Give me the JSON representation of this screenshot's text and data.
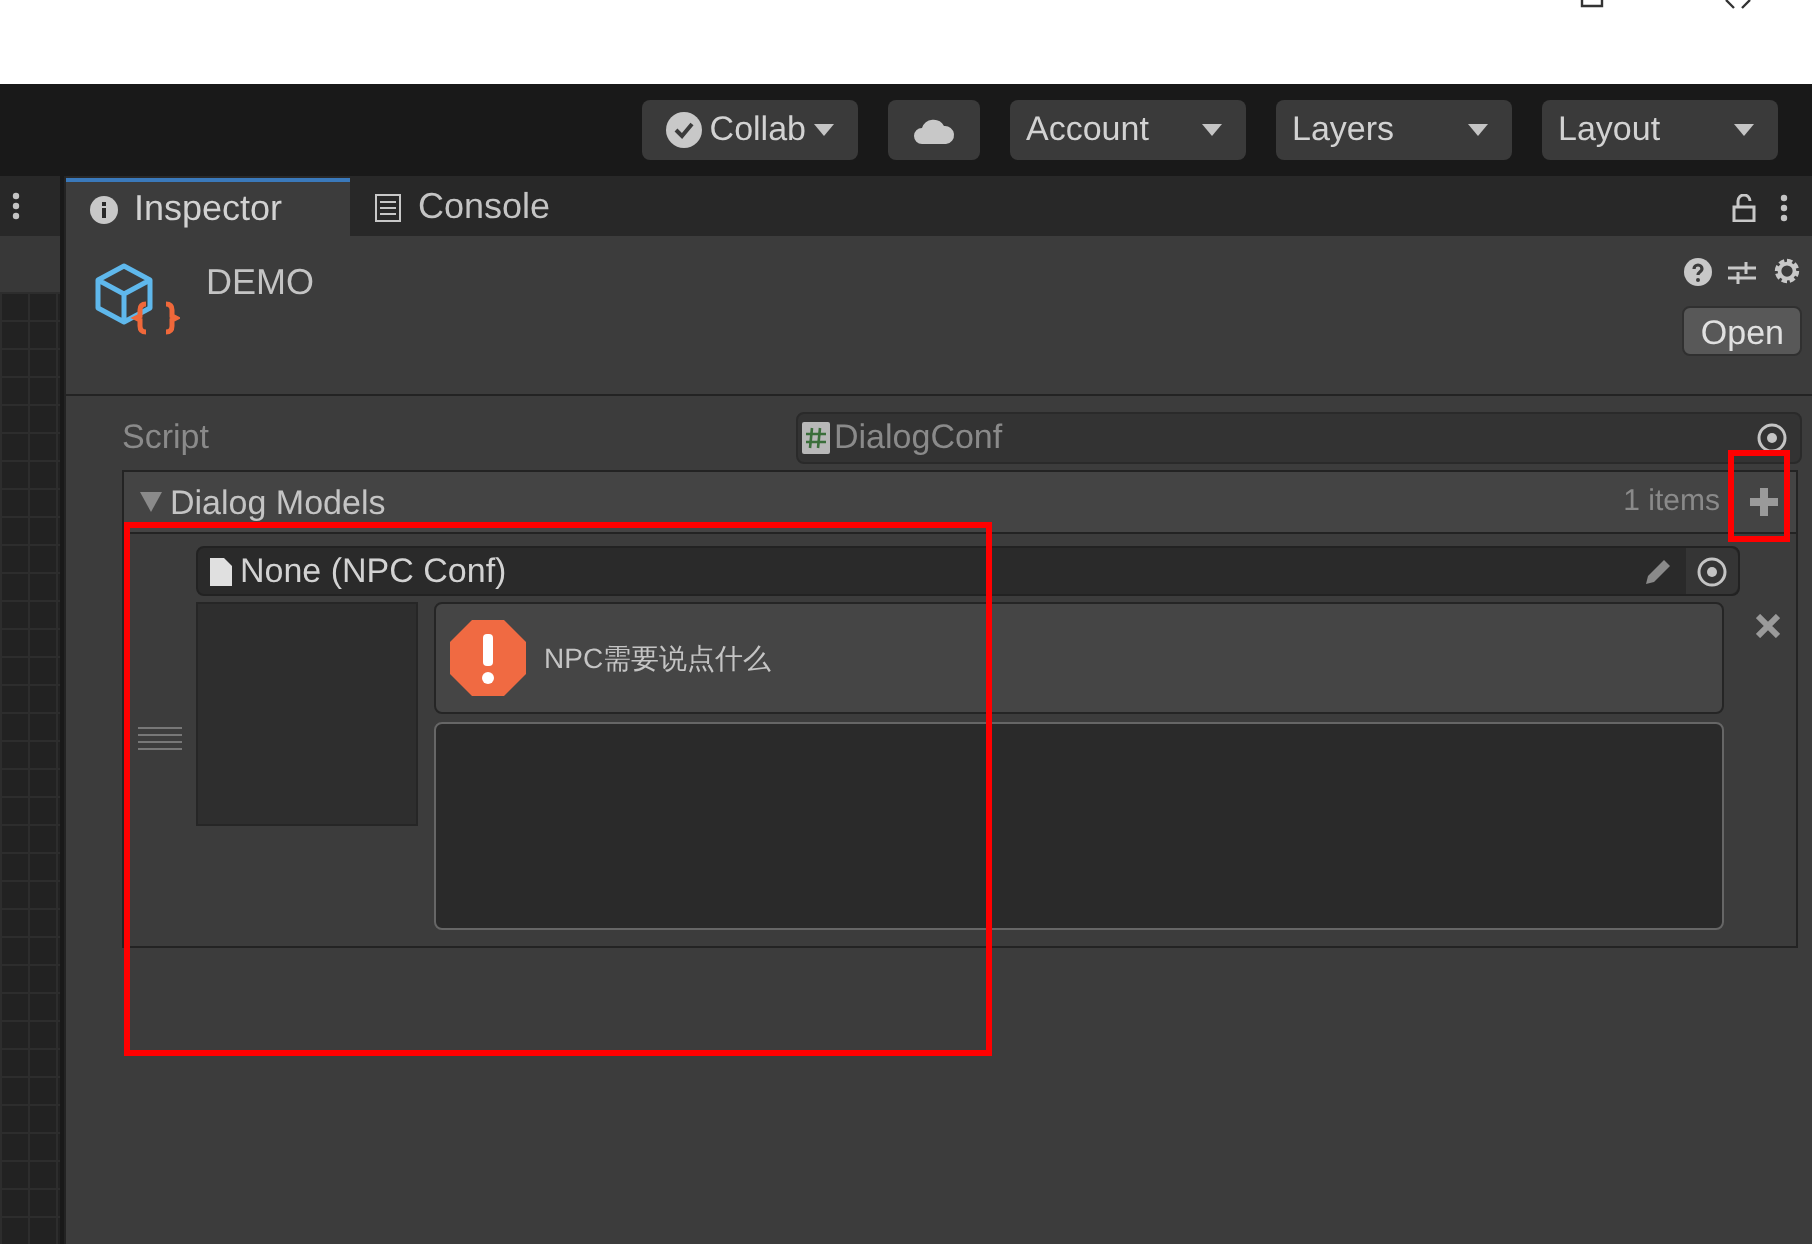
{
  "toolbar": {
    "buttons": [
      {
        "kind": "collab",
        "label": "Collab"
      },
      {
        "kind": "cloud"
      },
      {
        "kind": "dropdown",
        "label": "Account"
      },
      {
        "kind": "dropdown",
        "label": "Layers"
      },
      {
        "kind": "dropdown",
        "label": "Layout"
      }
    ]
  },
  "tabs": [
    {
      "label": "Inspector",
      "kind": "info",
      "selected": true
    },
    {
      "label": "Console",
      "kind": "console",
      "selected": false
    }
  ],
  "header": {
    "title": "DEMO",
    "open_button": "Open"
  },
  "script_field": {
    "label": "Script",
    "value": "DialogConf"
  },
  "list": {
    "title": "Dialog Models",
    "expanded": true,
    "count": "1 items",
    "items": [
      {
        "object_field": "None (NPC Conf)",
        "warning": "NPC需要说点什么"
      }
    ]
  }
}
